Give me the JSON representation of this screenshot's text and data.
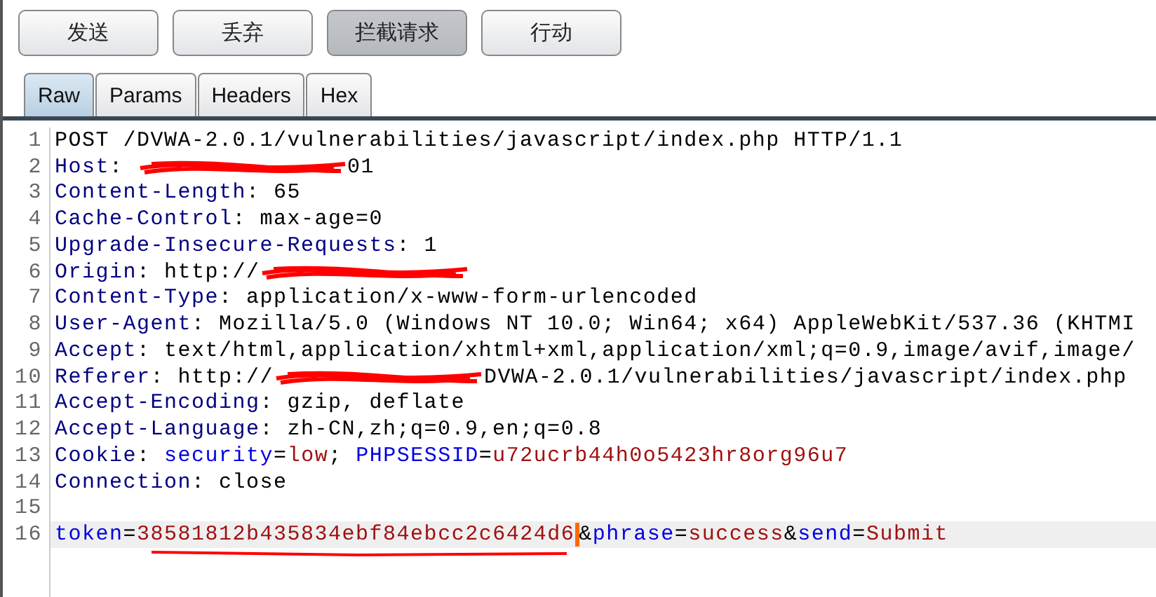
{
  "buttons": [
    {
      "label": "发送",
      "selected": false
    },
    {
      "label": "丢弃",
      "selected": false
    },
    {
      "label": "拦截请求",
      "selected": true
    },
    {
      "label": "行动",
      "selected": false
    }
  ],
  "tabs": [
    {
      "label": "Raw",
      "selected": true
    },
    {
      "label": "Params",
      "selected": false
    },
    {
      "label": "Headers",
      "selected": false
    },
    {
      "label": "Hex",
      "selected": false
    }
  ],
  "editor": {
    "lines": [
      {
        "number": "1",
        "selected": false,
        "segments": [
          {
            "kind": "plain",
            "text": "POST /DVWA-2.0.1/vulnerabilities/javascript/index.php HTTP/1.1"
          }
        ]
      },
      {
        "number": "2",
        "selected": false,
        "segments": [
          {
            "kind": "header",
            "text": "Host"
          },
          {
            "kind": "plain",
            "text": ": "
          },
          {
            "kind": "redacted"
          },
          {
            "kind": "plain",
            "text": "01"
          }
        ]
      },
      {
        "number": "3",
        "selected": false,
        "segments": [
          {
            "kind": "header",
            "text": "Content-Length"
          },
          {
            "kind": "plain",
            "text": ": 65"
          }
        ]
      },
      {
        "number": "4",
        "selected": false,
        "segments": [
          {
            "kind": "header",
            "text": "Cache-Control"
          },
          {
            "kind": "plain",
            "text": ": max-age=0"
          }
        ]
      },
      {
        "number": "5",
        "selected": false,
        "segments": [
          {
            "kind": "header",
            "text": "Upgrade-Insecure-Requests"
          },
          {
            "kind": "plain",
            "text": ": 1"
          }
        ]
      },
      {
        "number": "6",
        "selected": false,
        "segments": [
          {
            "kind": "header",
            "text": "Origin"
          },
          {
            "kind": "plain",
            "text": ": http://"
          },
          {
            "kind": "redacted"
          }
        ]
      },
      {
        "number": "7",
        "selected": false,
        "segments": [
          {
            "kind": "header",
            "text": "Content-Type"
          },
          {
            "kind": "plain",
            "text": ": application/x-www-form-urlencoded"
          }
        ]
      },
      {
        "number": "8",
        "selected": false,
        "segments": [
          {
            "kind": "header",
            "text": "User-Agent"
          },
          {
            "kind": "plain",
            "text": ": Mozilla/5.0 (Windows NT 10.0; Win64; x64) AppleWebKit/537.36 (KHTMI"
          }
        ]
      },
      {
        "number": "9",
        "selected": false,
        "segments": [
          {
            "kind": "header",
            "text": "Accept"
          },
          {
            "kind": "plain",
            "text": ": text/html,application/xhtml+xml,application/xml;q=0.9,image/avif,image/"
          }
        ]
      },
      {
        "number": "10",
        "selected": false,
        "segments": [
          {
            "kind": "header",
            "text": "Referer"
          },
          {
            "kind": "plain",
            "text": ": http://"
          },
          {
            "kind": "redacted"
          },
          {
            "kind": "plain",
            "text": "DVWA-2.0.1/vulnerabilities/javascript/index.php"
          }
        ]
      },
      {
        "number": "11",
        "selected": false,
        "segments": [
          {
            "kind": "header",
            "text": "Accept-Encoding"
          },
          {
            "kind": "plain",
            "text": ": gzip, deflate"
          }
        ]
      },
      {
        "number": "12",
        "selected": false,
        "segments": [
          {
            "kind": "header",
            "text": "Accept-Language"
          },
          {
            "kind": "plain",
            "text": ": zh-CN,zh;q=0.9,en;q=0.8"
          }
        ]
      },
      {
        "number": "13",
        "selected": false,
        "segments": [
          {
            "kind": "header",
            "text": "Cookie"
          },
          {
            "kind": "plain",
            "text": ": "
          },
          {
            "kind": "param",
            "text": "security"
          },
          {
            "kind": "plain",
            "text": "="
          },
          {
            "kind": "value",
            "text": "low"
          },
          {
            "kind": "plain",
            "text": "; "
          },
          {
            "kind": "param",
            "text": "PHPSESSID"
          },
          {
            "kind": "plain",
            "text": "="
          },
          {
            "kind": "value",
            "text": "u72ucrb44h0o5423hr8org96u7"
          }
        ]
      },
      {
        "number": "14",
        "selected": false,
        "segments": [
          {
            "kind": "header",
            "text": "Connection"
          },
          {
            "kind": "plain",
            "text": ": close"
          }
        ]
      },
      {
        "number": "15",
        "selected": false
      },
      {
        "number": "16",
        "selected": true,
        "segments": [
          {
            "kind": "param",
            "text": "token"
          },
          {
            "kind": "plain",
            "text": "="
          },
          {
            "kind": "value",
            "text": "38581812b435834ebf84ebcc2c6424d6"
          },
          {
            "kind": "caret"
          },
          {
            "kind": "plain",
            "text": "&"
          },
          {
            "kind": "param",
            "text": "phrase"
          },
          {
            "kind": "plain",
            "text": "="
          },
          {
            "kind": "value",
            "text": "success"
          },
          {
            "kind": "plain",
            "text": "&"
          },
          {
            "kind": "param",
            "text": "send"
          },
          {
            "kind": "plain",
            "text": "="
          },
          {
            "kind": "value",
            "text": "Submit"
          }
        ]
      }
    ]
  }
}
